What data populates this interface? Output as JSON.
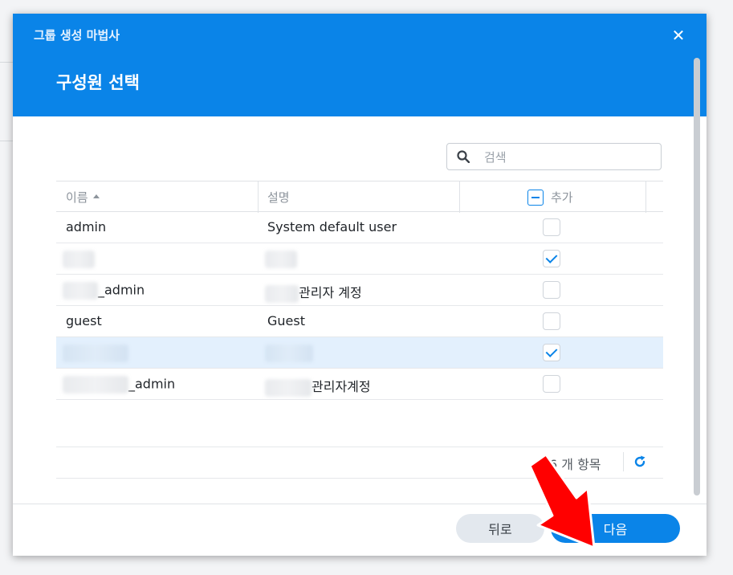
{
  "wizard": {
    "title": "그룹 생성 마법사",
    "step_title": "구성원 선택",
    "close_icon": "close-icon"
  },
  "search": {
    "placeholder": "검색",
    "value": ""
  },
  "table": {
    "columns": [
      "이름",
      "설명",
      "추가"
    ],
    "sort": {
      "column": "이름",
      "direction": "ascending"
    },
    "header_checkbox_state": "indeterminate",
    "rows": [
      {
        "name": "admin",
        "description": "System default user",
        "added": false,
        "selected": false
      },
      {
        "name": "",
        "description": "",
        "added": true,
        "selected": false
      },
      {
        "name": "_admin",
        "description": "관리자 계정",
        "added": false,
        "selected": false
      },
      {
        "name": "guest",
        "description": "Guest",
        "added": false,
        "selected": false
      },
      {
        "name": "",
        "description": "",
        "added": true,
        "selected": true
      },
      {
        "name": "_admin",
        "description": "관리자계정",
        "added": false,
        "selected": false
      }
    ]
  },
  "pager": {
    "count_text": "6 개 항목",
    "refresh_icon": "refresh-icon"
  },
  "footer": {
    "back_label": "뒤로",
    "next_label": "다음"
  },
  "colors": {
    "accent": "#0a84e8",
    "selected_row": "#e3f0fd",
    "annotation_arrow": "#ff0000"
  }
}
